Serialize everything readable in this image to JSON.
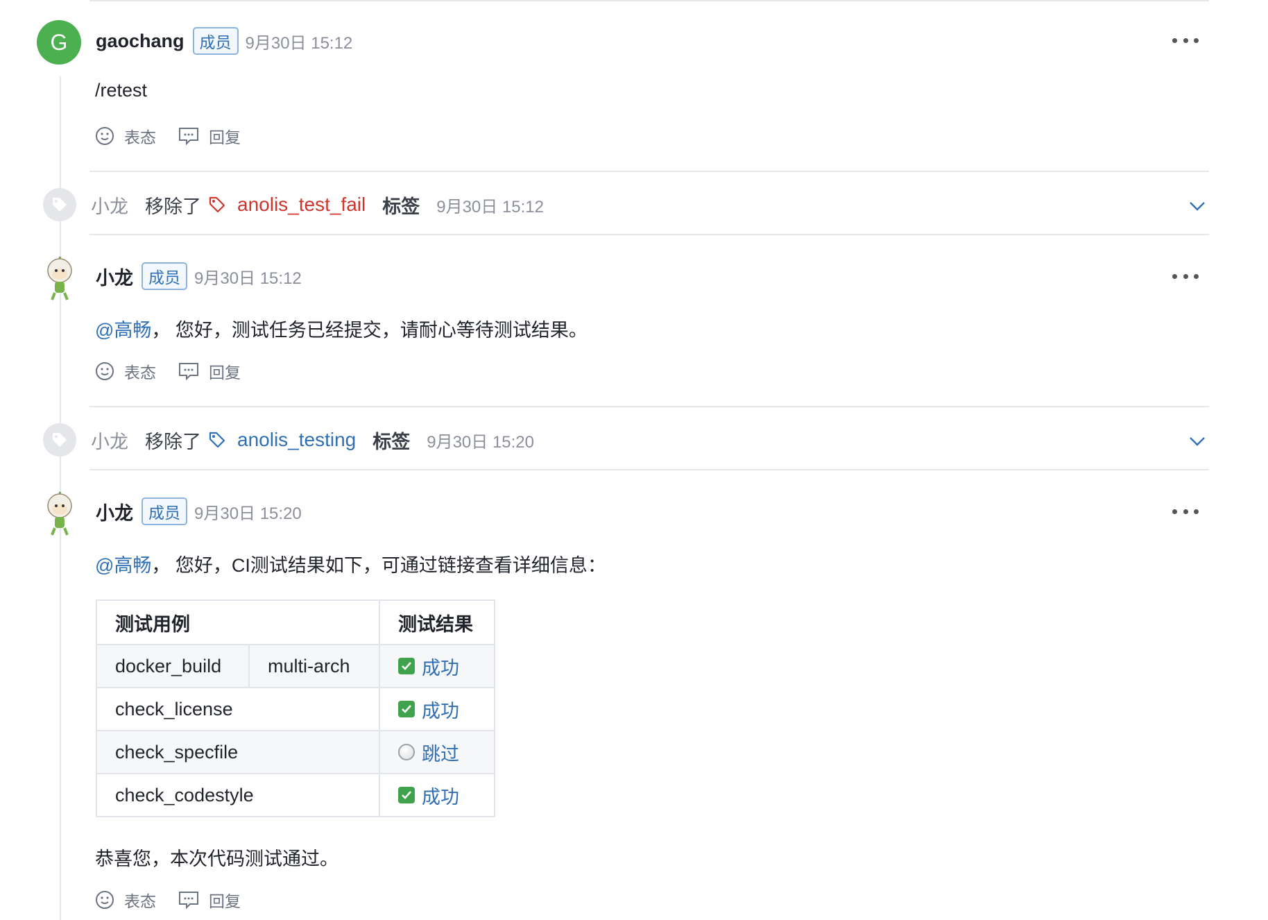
{
  "comment1": {
    "avatar_letter": "G",
    "username": "gaochang",
    "badge": "成员",
    "time": "9月30日 15:12",
    "body": "/retest",
    "react_label": "表态",
    "reply_label": "回复"
  },
  "event1": {
    "user": "小龙",
    "action": "移除了",
    "label": "anolis_test_fail",
    "label_color": "#d0342c",
    "word": "标签",
    "time": "9月30日 15:12"
  },
  "comment2": {
    "username": "小龙",
    "badge": "成员",
    "time": "9月30日 15:12",
    "mention": "@高畅",
    "body": "， 您好，测试任务已经提交，请耐心等待测试结果。",
    "react_label": "表态",
    "reply_label": "回复"
  },
  "event2": {
    "user": "小龙",
    "action": "移除了",
    "label": "anolis_testing",
    "label_color": "#2f6fb5",
    "word": "标签",
    "time": "9月30日 15:20"
  },
  "comment3": {
    "username": "小龙",
    "badge": "成员",
    "time": "9月30日 15:20",
    "mention": "@高畅",
    "body": "， 您好，CI测试结果如下，可通过链接查看详细信息：",
    "table": {
      "headers": [
        "测试用例",
        "测试结果"
      ],
      "rows": [
        {
          "case": "docker_build",
          "sub": "multi-arch",
          "result": "成功",
          "status": "success"
        },
        {
          "case": "check_license",
          "result": "成功",
          "status": "success"
        },
        {
          "case": "check_specfile",
          "result": "跳过",
          "status": "skipped"
        },
        {
          "case": "check_codestyle",
          "result": "成功",
          "status": "success"
        }
      ]
    },
    "footer": "恭喜您，本次代码测试通过。",
    "react_label": "表态",
    "reply_label": "回复"
  },
  "colors": {
    "accent": "#2f6fb5",
    "avatar_green": "#4caf50",
    "success": "#3fa34d"
  }
}
